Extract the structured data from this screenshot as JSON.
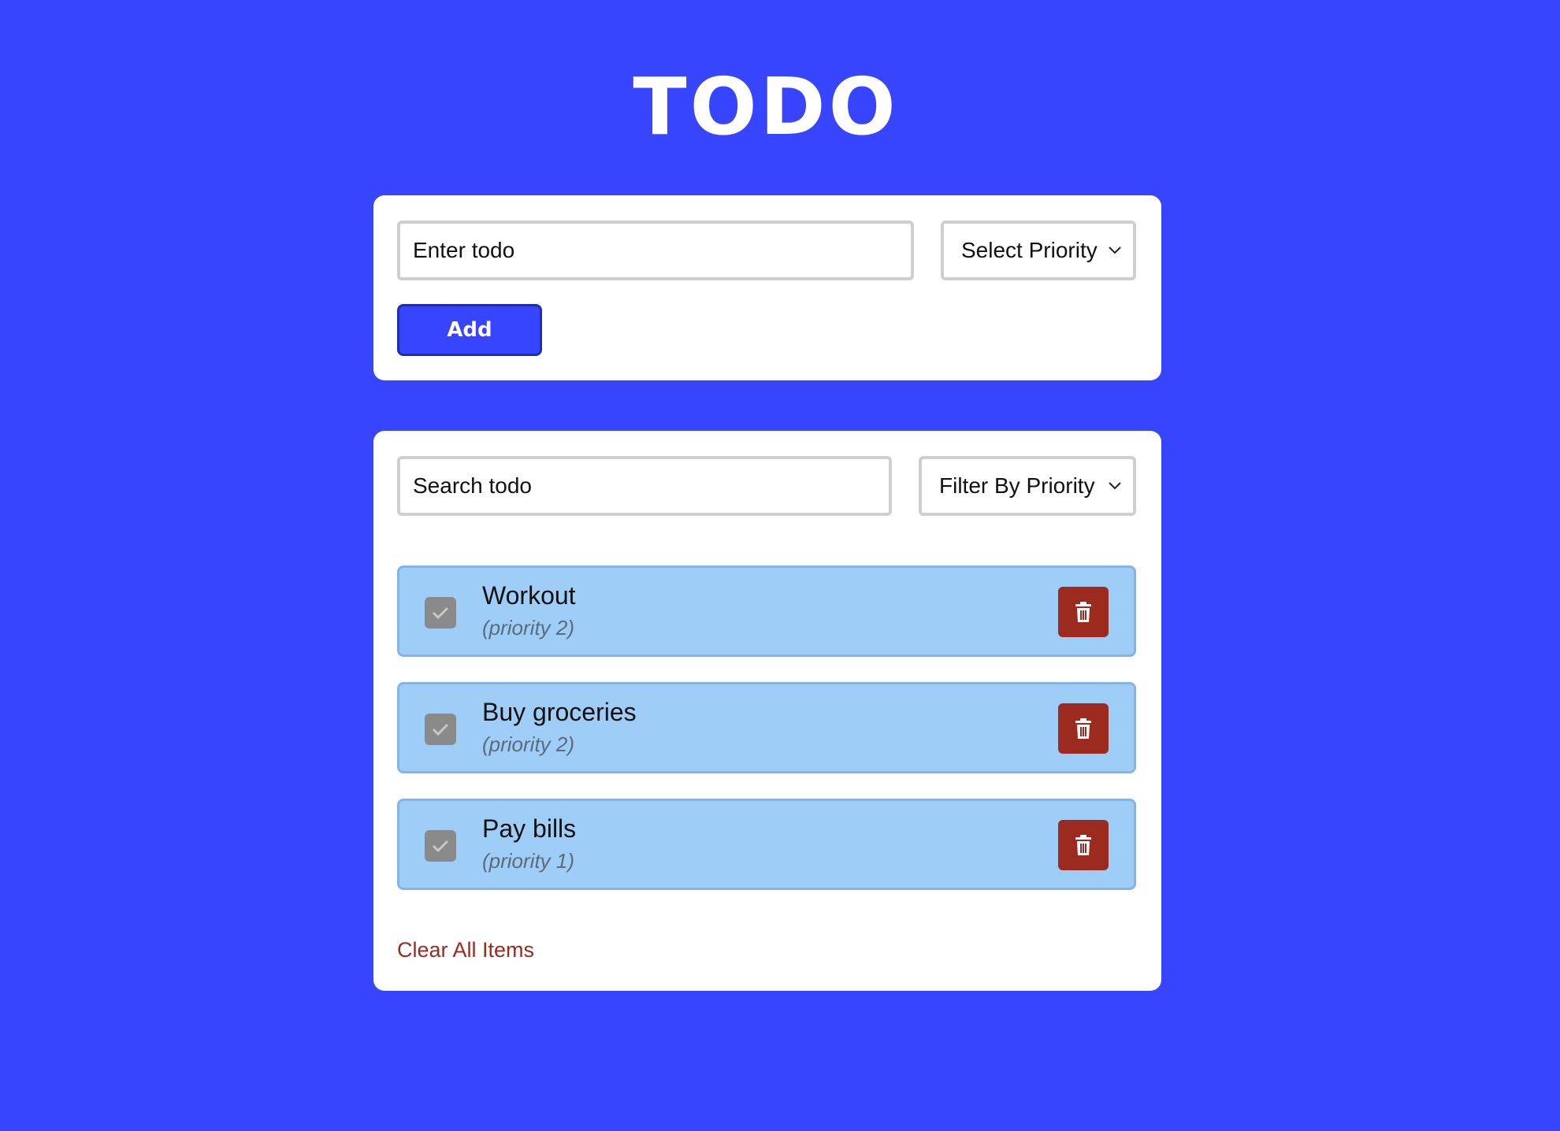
{
  "app": {
    "title": "TODO"
  },
  "add_form": {
    "todo_placeholder": "Enter todo",
    "priority_select_label": "Select Priority",
    "add_button_label": "Add"
  },
  "list_panel": {
    "search_placeholder": "Search todo",
    "filter_select_label": "Filter By Priority",
    "items": [
      {
        "text": "Workout",
        "priority": "(priority 2)",
        "completed": true
      },
      {
        "text": "Buy groceries",
        "priority": "(priority 2)",
        "completed": true
      },
      {
        "text": "Pay bills",
        "priority": "(priority 1)",
        "completed": true
      }
    ],
    "clear_all_label": "Clear All Items"
  },
  "icons": {
    "check": "check-icon",
    "delete": "trash-icon",
    "dropdown": "chevron-down-icon"
  },
  "colors": {
    "background": "#3745ff",
    "item_background": "#9ecdf7",
    "delete_button": "#9c2a1e",
    "clear_link": "#9c2a1e",
    "checkbox": "#8a8a8a"
  }
}
